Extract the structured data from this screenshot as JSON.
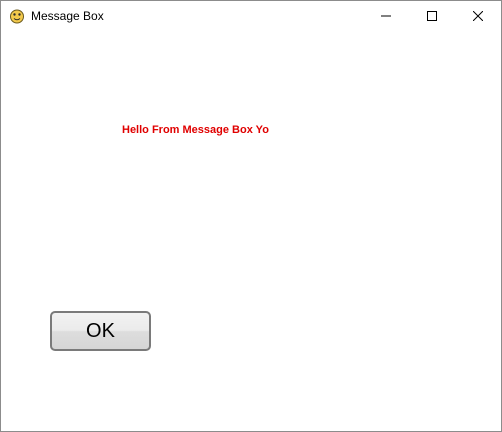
{
  "window": {
    "title": "Message Box",
    "controls": {
      "minimize_icon": "minimize-icon",
      "maximize_icon": "maximize-icon",
      "close_icon": "close-icon"
    }
  },
  "content": {
    "message": "Hello From Message Box Yo",
    "message_color": "#e00000",
    "ok_label": "OK"
  }
}
